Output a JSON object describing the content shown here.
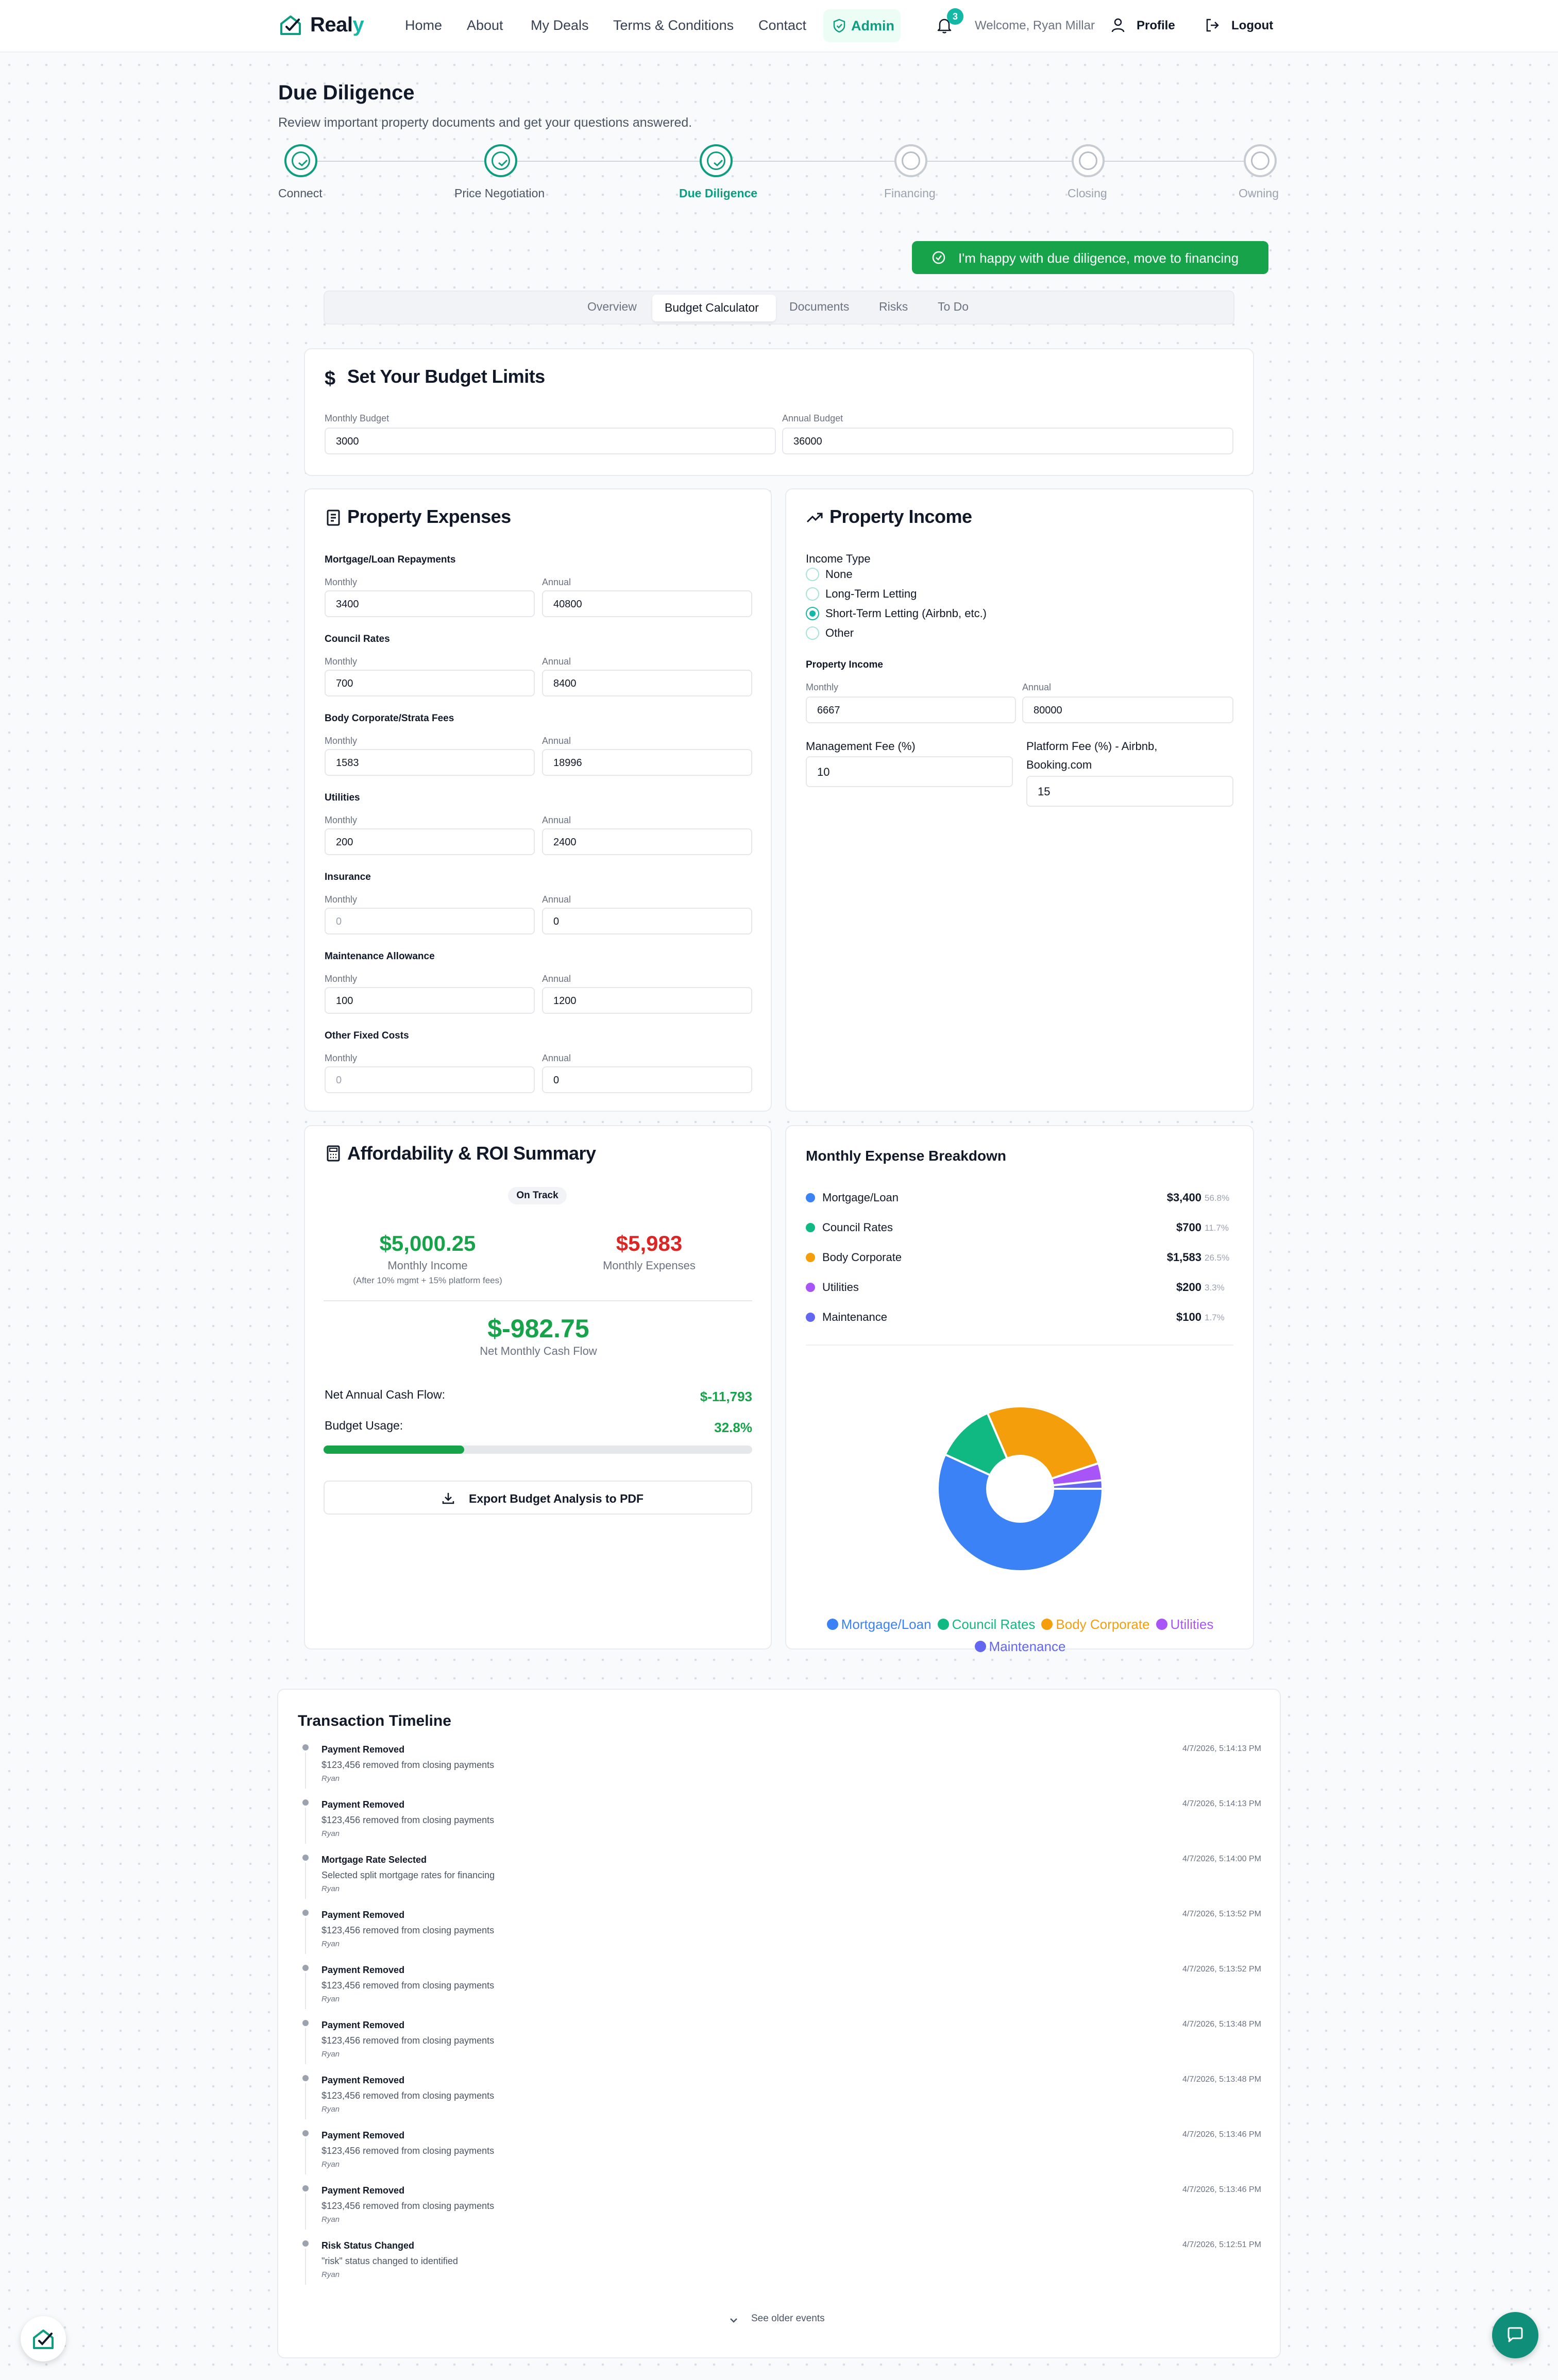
{
  "brand": {
    "name_main": "Real",
    "name_accent": "y"
  },
  "nav": {
    "links": [
      "Home",
      "About",
      "My Deals",
      "Terms & Conditions",
      "Contact"
    ],
    "admin": "Admin",
    "notifications_count": "3",
    "welcome": "Welcome, Ryan Millar",
    "profile": "Profile",
    "logout": "Logout"
  },
  "header": {
    "title": "Due Diligence",
    "subtitle": "Review important property documents and get your questions answered."
  },
  "stepper": [
    {
      "label": "Connect",
      "state": "done"
    },
    {
      "label": "Price Negotiation",
      "state": "done"
    },
    {
      "label": "Due Diligence",
      "state": "current"
    },
    {
      "label": "Financing",
      "state": "todo"
    },
    {
      "label": "Closing",
      "state": "todo"
    },
    {
      "label": "Owning",
      "state": "todo"
    }
  ],
  "cta_label": "I'm happy with due diligence, move to financing",
  "tabs": {
    "items": [
      "Overview",
      "Budget Calculator",
      "Documents",
      "Risks",
      "To Do"
    ],
    "active": "Budget Calculator"
  },
  "budget_limits": {
    "title": "Set Your Budget Limits",
    "monthly_label": "Monthly Budget",
    "monthly_value": "3000",
    "annual_label": "Annual Budget",
    "annual_value": "36000"
  },
  "expenses": {
    "title": "Property Expenses",
    "monthly_label": "Monthly",
    "annual_label": "Annual",
    "items": [
      {
        "label": "Mortgage/Loan Repayments",
        "monthly": "3400",
        "annual": "40800"
      },
      {
        "label": "Council Rates",
        "monthly": "700",
        "annual": "8400"
      },
      {
        "label": "Body Corporate/Strata Fees",
        "monthly": "1583",
        "annual": "18996"
      },
      {
        "label": "Utilities",
        "monthly": "200",
        "annual": "2400"
      },
      {
        "label": "Insurance",
        "monthly": "0",
        "annual": "0"
      },
      {
        "label": "Maintenance Allowance",
        "monthly": "100",
        "annual": "1200"
      },
      {
        "label": "Other Fixed Costs",
        "monthly": "0",
        "annual": "0"
      }
    ]
  },
  "income": {
    "title": "Property Income",
    "type_label": "Income Type",
    "types": [
      "None",
      "Long-Term Letting",
      "Short-Term Letting (Airbnb, etc.)",
      "Other"
    ],
    "selected_type": "Short-Term Letting (Airbnb, etc.)",
    "property_income_label": "Property Income",
    "monthly_label": "Monthly",
    "monthly_value": "6667",
    "annual_label": "Annual",
    "annual_value": "80000",
    "mgmt_fee_label": "Management Fee (%)",
    "mgmt_fee_value": "10",
    "platform_fee_label_1": "Platform Fee (%) - Airbnb,",
    "platform_fee_label_2": "Booking.com",
    "platform_fee_value": "15"
  },
  "summary": {
    "title": "Affordability & ROI Summary",
    "status": "On Track",
    "monthly_income": "$5,000.25",
    "monthly_income_label": "Monthly Income",
    "monthly_income_note": "(After 10% mgmt + 15% platform fees)",
    "monthly_expenses": "$5,983",
    "monthly_expenses_label": "Monthly Expenses",
    "net_monthly": "$-982.75",
    "net_monthly_label": "Net Monthly Cash Flow",
    "net_annual_label": "Net Annual Cash Flow:",
    "net_annual_value": "$-11,793",
    "budget_usage_label": "Budget Usage:",
    "budget_usage_value": "32.8%",
    "budget_usage_fraction": 0.328,
    "export_label": "Export Budget Analysis to PDF"
  },
  "breakdown": {
    "title": "Monthly Expense Breakdown",
    "items": [
      {
        "name": "Mortgage/Loan",
        "value": "$3,400",
        "pct": "56.8%",
        "color": "#3b82f6"
      },
      {
        "name": "Council Rates",
        "value": "$700",
        "pct": "11.7%",
        "color": "#10b981"
      },
      {
        "name": "Body Corporate",
        "value": "$1,583",
        "pct": "26.5%",
        "color": "#f59e0b"
      },
      {
        "name": "Utilities",
        "value": "$200",
        "pct": "3.3%",
        "color": "#a855f7"
      },
      {
        "name": "Maintenance",
        "value": "$100",
        "pct": "1.7%",
        "color": "#6366f1"
      }
    ]
  },
  "chart_data": {
    "type": "pie",
    "categories": [
      "Mortgage/Loan",
      "Council Rates",
      "Body Corporate",
      "Utilities",
      "Maintenance"
    ],
    "values": [
      3400,
      700,
      1583,
      200,
      100
    ],
    "colors": [
      "#3b82f6",
      "#10b981",
      "#f59e0b",
      "#a855f7",
      "#6366f1"
    ],
    "legend": "bottom",
    "donut": true
  },
  "timeline": {
    "title": "Transaction Timeline",
    "events": [
      {
        "title": "Payment Removed",
        "desc": "$123,456 removed from closing payments",
        "user": "Ryan",
        "time": "4/7/2026, 5:14:13 PM"
      },
      {
        "title": "Payment Removed",
        "desc": "$123,456 removed from closing payments",
        "user": "Ryan",
        "time": "4/7/2026, 5:14:13 PM"
      },
      {
        "title": "Mortgage Rate Selected",
        "desc": "Selected split mortgage rates for financing",
        "user": "Ryan",
        "time": "4/7/2026, 5:14:00 PM"
      },
      {
        "title": "Payment Removed",
        "desc": "$123,456 removed from closing payments",
        "user": "Ryan",
        "time": "4/7/2026, 5:13:52 PM"
      },
      {
        "title": "Payment Removed",
        "desc": "$123,456 removed from closing payments",
        "user": "Ryan",
        "time": "4/7/2026, 5:13:52 PM"
      },
      {
        "title": "Payment Removed",
        "desc": "$123,456 removed from closing payments",
        "user": "Ryan",
        "time": "4/7/2026, 5:13:48 PM"
      },
      {
        "title": "Payment Removed",
        "desc": "$123,456 removed from closing payments",
        "user": "Ryan",
        "time": "4/7/2026, 5:13:48 PM"
      },
      {
        "title": "Payment Removed",
        "desc": "$123,456 removed from closing payments",
        "user": "Ryan",
        "time": "4/7/2026, 5:13:46 PM"
      },
      {
        "title": "Payment Removed",
        "desc": "$123,456 removed from closing payments",
        "user": "Ryan",
        "time": "4/7/2026, 5:13:46 PM"
      },
      {
        "title": "Risk Status Changed",
        "desc": "\"risk\" status changed to identified",
        "user": "Ryan",
        "time": "4/7/2026, 5:12:51 PM"
      }
    ],
    "see_older": "See older events"
  }
}
